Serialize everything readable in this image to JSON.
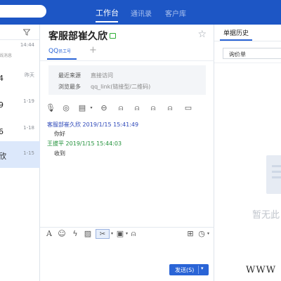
{
  "nav": {
    "tabs": [
      "工作台",
      "通讯录",
      "客户库"
    ],
    "active": 0
  },
  "conversations": [
    {
      "name": "",
      "time": "14:44",
      "sub": "线消息"
    },
    {
      "name": "4",
      "time": "昨天"
    },
    {
      "name": "9",
      "time": "1-19"
    },
    {
      "name": "6",
      "time": "1-18"
    },
    {
      "name": "欣",
      "time": "1-15",
      "selected": true
    }
  ],
  "chat": {
    "title": "客服部崔久欣",
    "tab": {
      "main": "QQ",
      "small": "员工号"
    },
    "info": [
      {
        "label": "最近来源",
        "value": "直接访问"
      },
      {
        "label": "浏览最多",
        "value": "qq_link(链接型/二维码)"
      }
    ],
    "messages": [
      {
        "sender": "客服部崔久欣",
        "time": "2019/1/15 15:41:49",
        "text": "你好",
        "color": "#2b46b8"
      },
      {
        "sender": "王拔平",
        "time": "2019/1/15 15:44:03",
        "text": "收到",
        "color": "#21913a"
      }
    ],
    "send_label": "发送(S)"
  },
  "right": {
    "tab": "单据历史",
    "select_value": "询价单",
    "empty_text": "暂无此"
  },
  "watermark": "WWW",
  "colors": {
    "header": "#1d56c5",
    "accent": "#2a64d6",
    "selected_row": "#dce8fb"
  }
}
